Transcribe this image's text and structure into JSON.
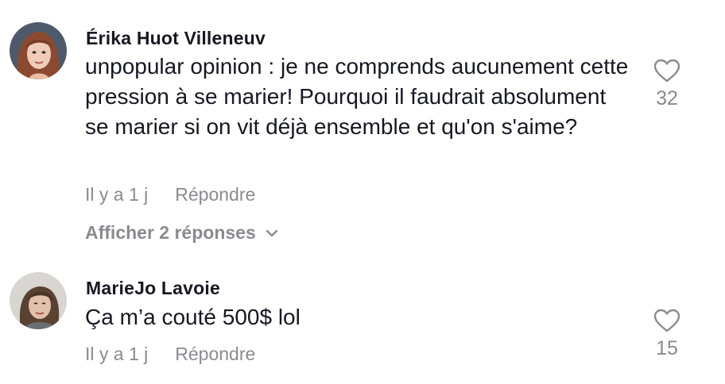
{
  "comments": [
    {
      "username": "Érika Huot Villeneuv",
      "text": "unpopular opinion : je ne comprends aucunement cette pression à se marier! Pourquoi il faudrait absolument se marier si on vit déjà ensemble et qu'on s'aime?",
      "time": "Il y a 1 j",
      "reply_label": "Répondre",
      "view_replies": "Afficher 2 réponses",
      "like_count": "32"
    },
    {
      "username": "MarieJo Lavoie",
      "text": "Ça m’a couté 500$ lol",
      "time": "Il y a 1 j",
      "reply_label": "Répondre",
      "like_count": "15"
    }
  ],
  "colors": {
    "text_primary": "#161823",
    "text_secondary": "#8a8b91"
  }
}
